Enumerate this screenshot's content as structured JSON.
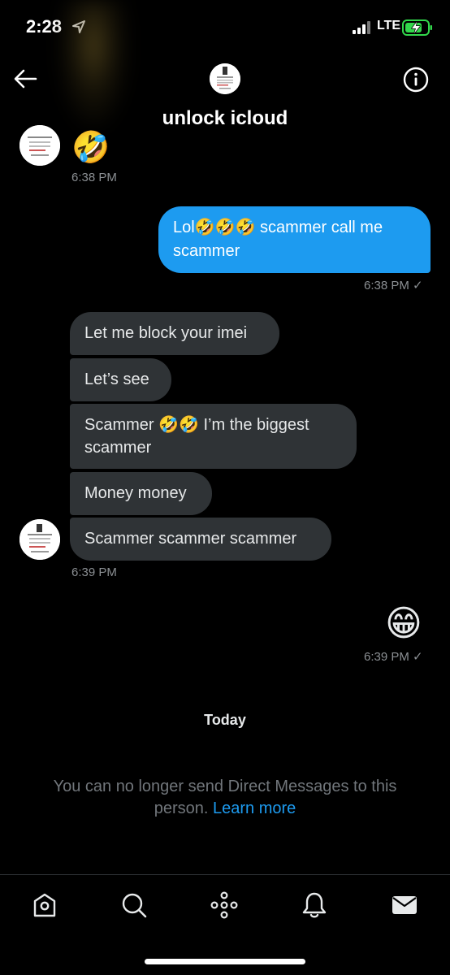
{
  "status_bar": {
    "time": "2:28",
    "network": "LTE"
  },
  "header": {
    "title": "unlock icloud",
    "avatar_text": "iPhone 6S-XS MAX"
  },
  "messages": [
    {
      "id": "m0",
      "direction": "in",
      "text": "🤣"
    },
    {
      "id": "ts0",
      "type": "timestamp",
      "text": "6:38 PM"
    },
    {
      "id": "m1",
      "direction": "out",
      "text": "Lol🤣🤣🤣 scammer call me scammer"
    },
    {
      "id": "ts1",
      "type": "timestamp",
      "text": "6:38 PM ✓"
    },
    {
      "id": "m2",
      "direction": "in",
      "text": "Let me block your imei"
    },
    {
      "id": "m3",
      "direction": "in",
      "text": "Let’s see"
    },
    {
      "id": "m4",
      "direction": "in",
      "text": "Scammer 🤣🤣 I’m the biggest scammer"
    },
    {
      "id": "m5",
      "direction": "in",
      "text": "Money money"
    },
    {
      "id": "m6",
      "direction": "in",
      "text": "Scammer scammer scammer"
    },
    {
      "id": "ts2",
      "type": "timestamp",
      "text": "6:39 PM"
    },
    {
      "id": "m7",
      "direction": "out",
      "text": "😁"
    },
    {
      "id": "ts3",
      "type": "timestamp",
      "text": "6:39 PM ✓"
    }
  ],
  "divider_label": "Today",
  "notice": {
    "text": "You can no longer send Direct Messages to this person.",
    "link": "Learn more"
  },
  "bottom_nav": [
    "home-icon",
    "search-icon",
    "spaces-icon",
    "notifications-icon",
    "messages-icon"
  ],
  "colors": {
    "background": "#000000",
    "incoming_bubble": "#2f3336",
    "outgoing_bubble": "#1d9bf0",
    "link": "#1d9bf0",
    "muted_text": "#71767b"
  }
}
